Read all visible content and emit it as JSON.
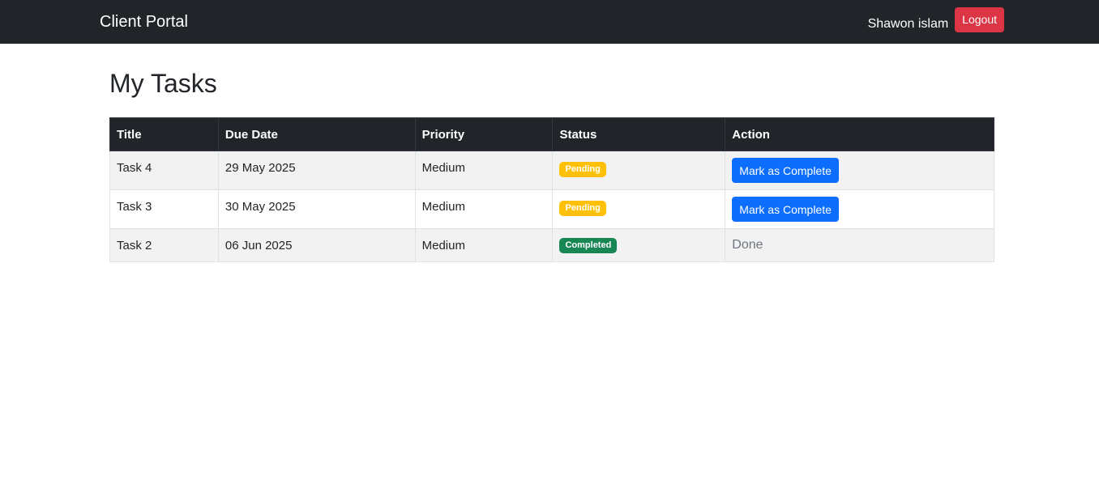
{
  "navbar": {
    "brand": "Client Portal",
    "username": "Shawon islam",
    "logout_label": "Logout"
  },
  "page": {
    "title": "My Tasks"
  },
  "table": {
    "headers": [
      "Title",
      "Due Date",
      "Priority",
      "Status",
      "Action"
    ],
    "rows": [
      {
        "title": "Task 4",
        "due_date": "29 May 2025",
        "priority": "Medium",
        "status": "Pending",
        "action": "Mark as Complete"
      },
      {
        "title": "Task 3",
        "due_date": "30 May 2025",
        "priority": "Medium",
        "status": "Pending",
        "action": "Mark as Complete"
      },
      {
        "title": "Task 2",
        "due_date": "06 Jun 2025",
        "priority": "Medium",
        "status": "Completed",
        "action": "Done"
      }
    ]
  },
  "colors": {
    "navbar_bg": "#212529",
    "logout_bg": "#dc3545",
    "primary": "#0d6efd",
    "pending": "#ffc107",
    "completed": "#198754"
  }
}
